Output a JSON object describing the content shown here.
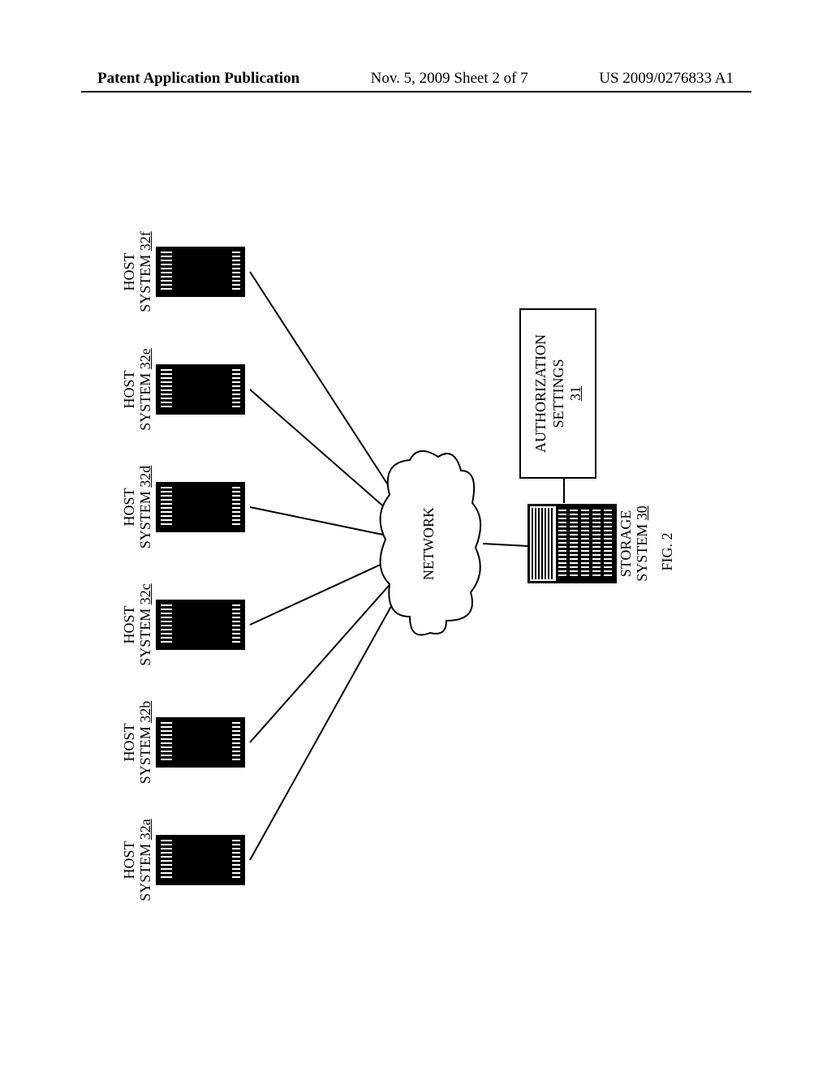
{
  "header": {
    "left": "Patent Application Publication",
    "center": "Nov. 5, 2009  Sheet 2 of 7",
    "right": "US 2009/0276833 A1"
  },
  "hosts": [
    {
      "label_top": "HOST",
      "label_bottom": "SYSTEM",
      "ref": "32a"
    },
    {
      "label_top": "HOST",
      "label_bottom": "SYSTEM",
      "ref": "32b"
    },
    {
      "label_top": "HOST",
      "label_bottom": "SYSTEM",
      "ref": "32c"
    },
    {
      "label_top": "HOST",
      "label_bottom": "SYSTEM",
      "ref": "32d"
    },
    {
      "label_top": "HOST",
      "label_bottom": "SYSTEM",
      "ref": "32e"
    },
    {
      "label_top": "HOST",
      "label_bottom": "SYSTEM",
      "ref": "32f"
    }
  ],
  "network_label": "NETWORK",
  "storage": {
    "label_top": "STORAGE",
    "label_bottom": "SYSTEM",
    "ref": "30"
  },
  "authorization": {
    "line1": "AUTHORIZATION",
    "line2": "SETTINGS",
    "ref": "31"
  },
  "figure_caption": "FIG. 2"
}
